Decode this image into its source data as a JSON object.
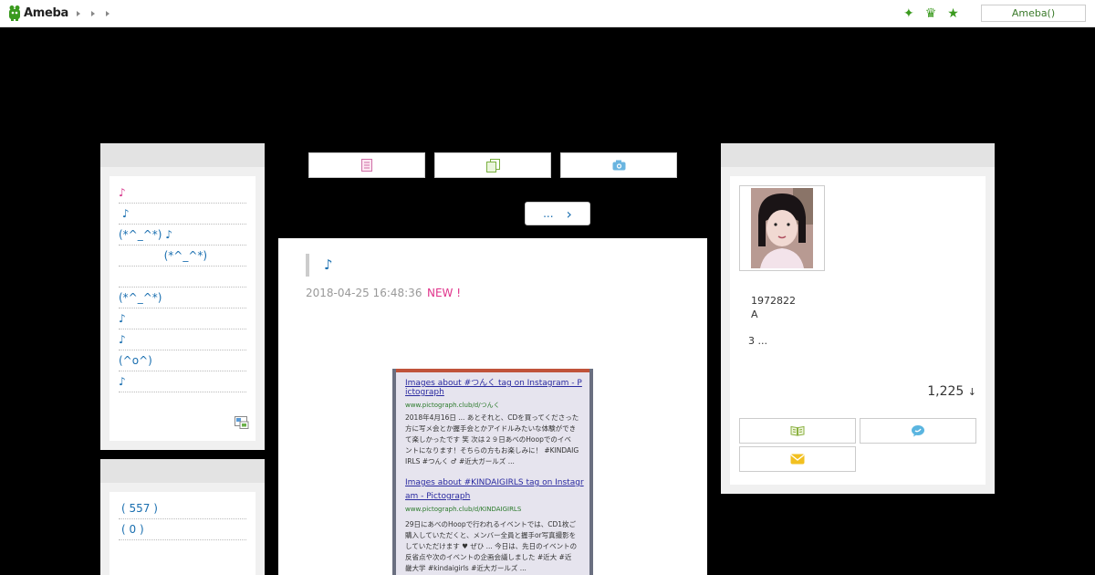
{
  "header": {
    "logo_text": "Ameba",
    "user_label": "Ameba()"
  },
  "left_menu": {
    "items": [
      {
        "label": "♪",
        "color": "#d6358b"
      },
      {
        "label": " ♪",
        "color": "#1a6fb0"
      },
      {
        "label": "(*^_^*) ♪",
        "color": "#1a6fb0"
      },
      {
        "label": "             (*^_^*)",
        "color": "#1a6fb0"
      },
      {
        "label": "",
        "color": "#1a6fb0"
      },
      {
        "label": "(*^_^*)",
        "color": "#1a6fb0"
      },
      {
        "label": "♪",
        "color": "#1a6fb0"
      },
      {
        "label": "♪",
        "color": "#1a6fb0"
      },
      {
        "label": "(^o^)",
        "color": "#1a6fb0"
      },
      {
        "label": "♪",
        "color": "#1a6fb0"
      }
    ]
  },
  "archive": {
    "items": [
      {
        "label": "( 557 )"
      },
      {
        "label": "( 0 )"
      }
    ]
  },
  "pager": {
    "ellipsis": "...",
    "next": "›"
  },
  "article": {
    "title": "♪",
    "date": "2018-04-25 16:48:36",
    "new_badge": "NEW !",
    "screenshot": {
      "line1": "Images about #つんく tag on Instagram - P",
      "line2": "ictograph",
      "url1": "www.pictograph.club/d/つんく",
      "body1": "2018年4月16日 ... あとそれと、CDを買ってくださった",
      "body2": "方に写メ会とか握手会とかアイドルみたいな体験ができ",
      "body3": "て楽しかったです 笑 次は２９日あべのHoopでのイベ",
      "body4": "ントになります！そちらの方もお楽しみに！ #KINDAIG",
      "body5": "IRLS #つんく ♂ #近大ガールズ ...",
      "line3": "Images about #KINDAIGIRLS tag on Instagr",
      "line4": "am - Pictograph",
      "url2": "www.pictograph.club/d/KINDAIGIRLS",
      "body6": "29日にあべのHoopで行われるイベントでは、CD1枚ご",
      "body7": "購入していただくと、メンバー全員と握手or写真撮影を",
      "body8": "していただけます ♥ ぜひ ... 今日は、先日のイベントの",
      "body9": "反省点や次のイベントの企画会議しました #近大 #近",
      "body10": "畿大学 #kindaigirls #近大ガールズ ..."
    }
  },
  "profile": {
    "line1": "1972822",
    "line2": "A",
    "more": "3 ...",
    "readers": "1,225",
    "readers_arrow": "↓"
  },
  "colors": {
    "link": "#1a6fb0",
    "accent_pink": "#e0338b",
    "brand_green": "#3a9a1e"
  }
}
